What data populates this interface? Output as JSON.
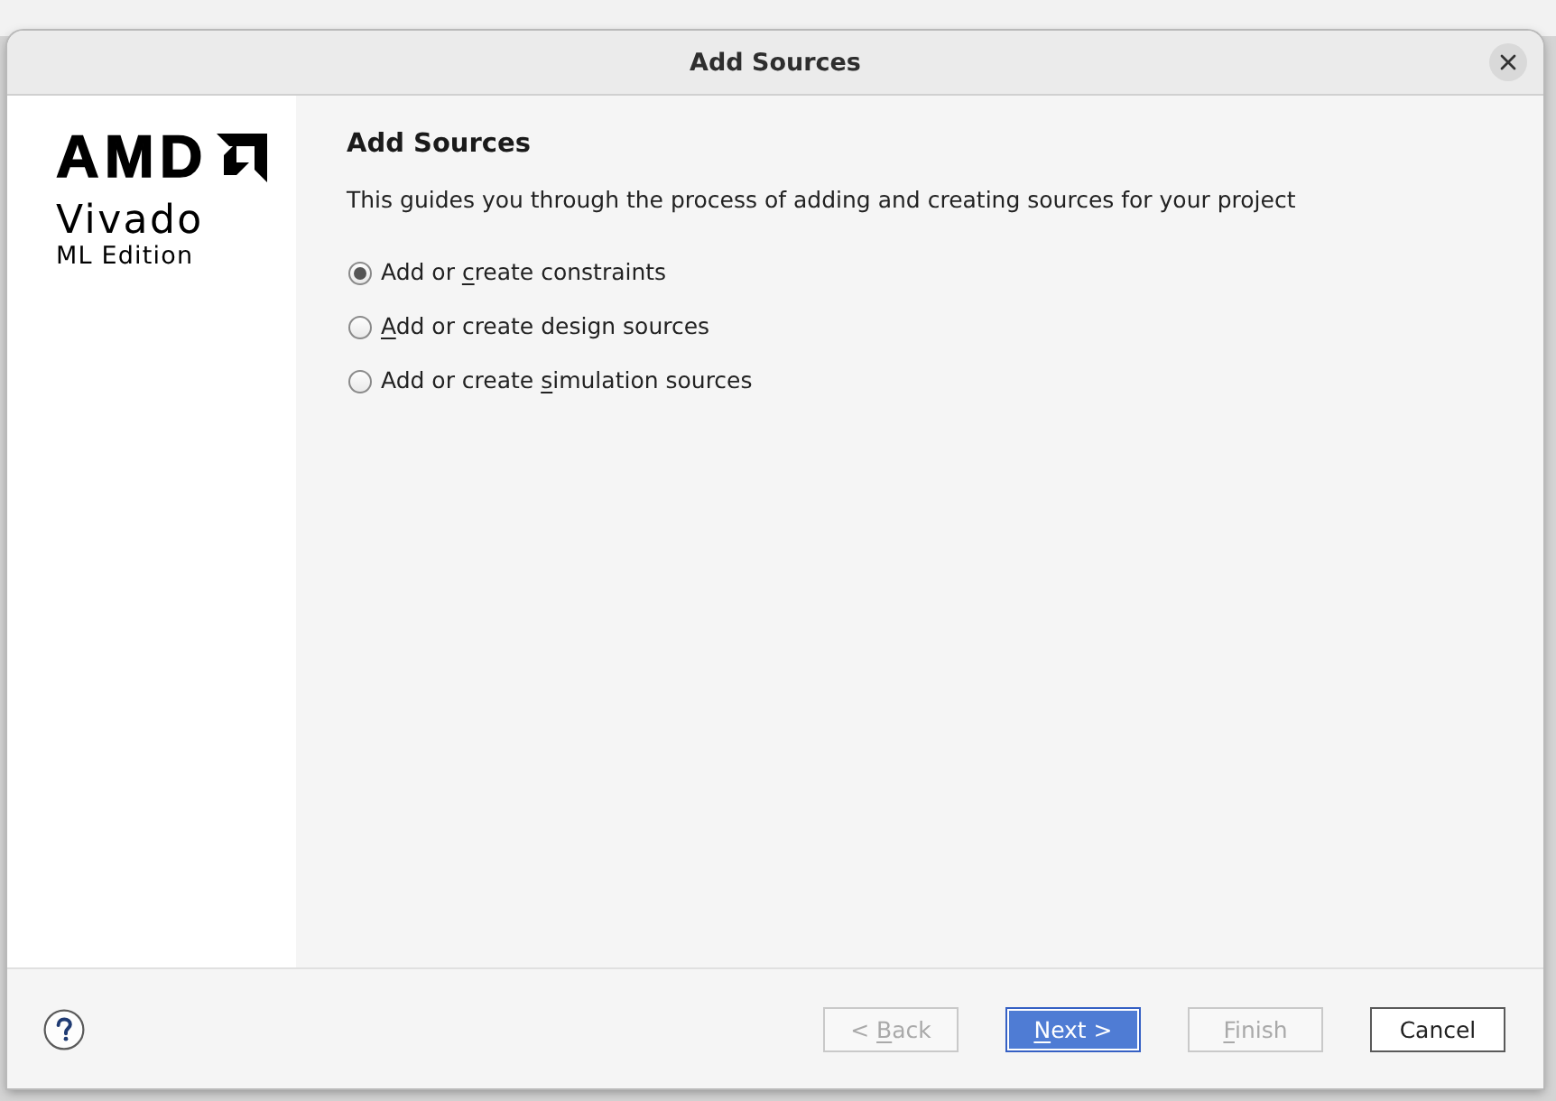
{
  "dialog": {
    "title": "Add Sources"
  },
  "logo": {
    "brand": "AMD",
    "product": "Vivado",
    "edition": "ML Edition"
  },
  "page": {
    "heading": "Add Sources",
    "description": "This guides you through the process of adding and creating sources for your project"
  },
  "options": [
    {
      "label": [
        {
          "text": "Add or "
        },
        {
          "text": "c",
          "underlined": true
        },
        {
          "text": "reate constraints"
        }
      ],
      "selected": true
    },
    {
      "label": [
        {
          "text": "A",
          "underlined": true
        },
        {
          "text": "dd or create design sources"
        }
      ],
      "selected": false
    },
    {
      "label": [
        {
          "text": "Add or create "
        },
        {
          "text": "s",
          "underlined": true
        },
        {
          "text": "imulation sources"
        }
      ],
      "selected": false
    }
  ],
  "buttons": [
    {
      "label": [
        {
          "text": "< "
        },
        {
          "text": "B",
          "underlined": true
        },
        {
          "text": "ack"
        }
      ],
      "disabled": true,
      "default": false
    },
    {
      "label": [
        {
          "text": "N",
          "underlined": true
        },
        {
          "text": "ext >"
        }
      ],
      "disabled": false,
      "default": true
    },
    {
      "label": [
        {
          "text": "F",
          "underlined": true
        },
        {
          "text": "inish"
        }
      ],
      "disabled": true,
      "default": false
    },
    {
      "label": [
        {
          "text": "Cancel"
        }
      ],
      "disabled": false,
      "default": false
    }
  ]
}
